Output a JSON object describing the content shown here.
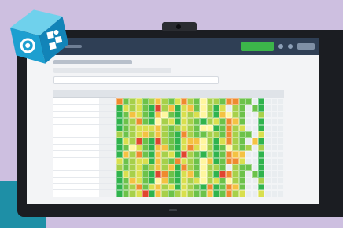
{
  "icons": {
    "badge": "app-cube-icon",
    "menu": "hamburger-menu-icon"
  },
  "colors": {
    "background": "#cdbfe0",
    "accent": "#1e8fa6",
    "button_green": "#3cb54a",
    "heat_palette": [
      "#2fb34d",
      "#6cc24a",
      "#a7d04a",
      "#d9df4e",
      "#f4c242",
      "#ef8a2f",
      "#e0452f",
      "#fff6a0",
      "#e9edf0"
    ]
  }
}
